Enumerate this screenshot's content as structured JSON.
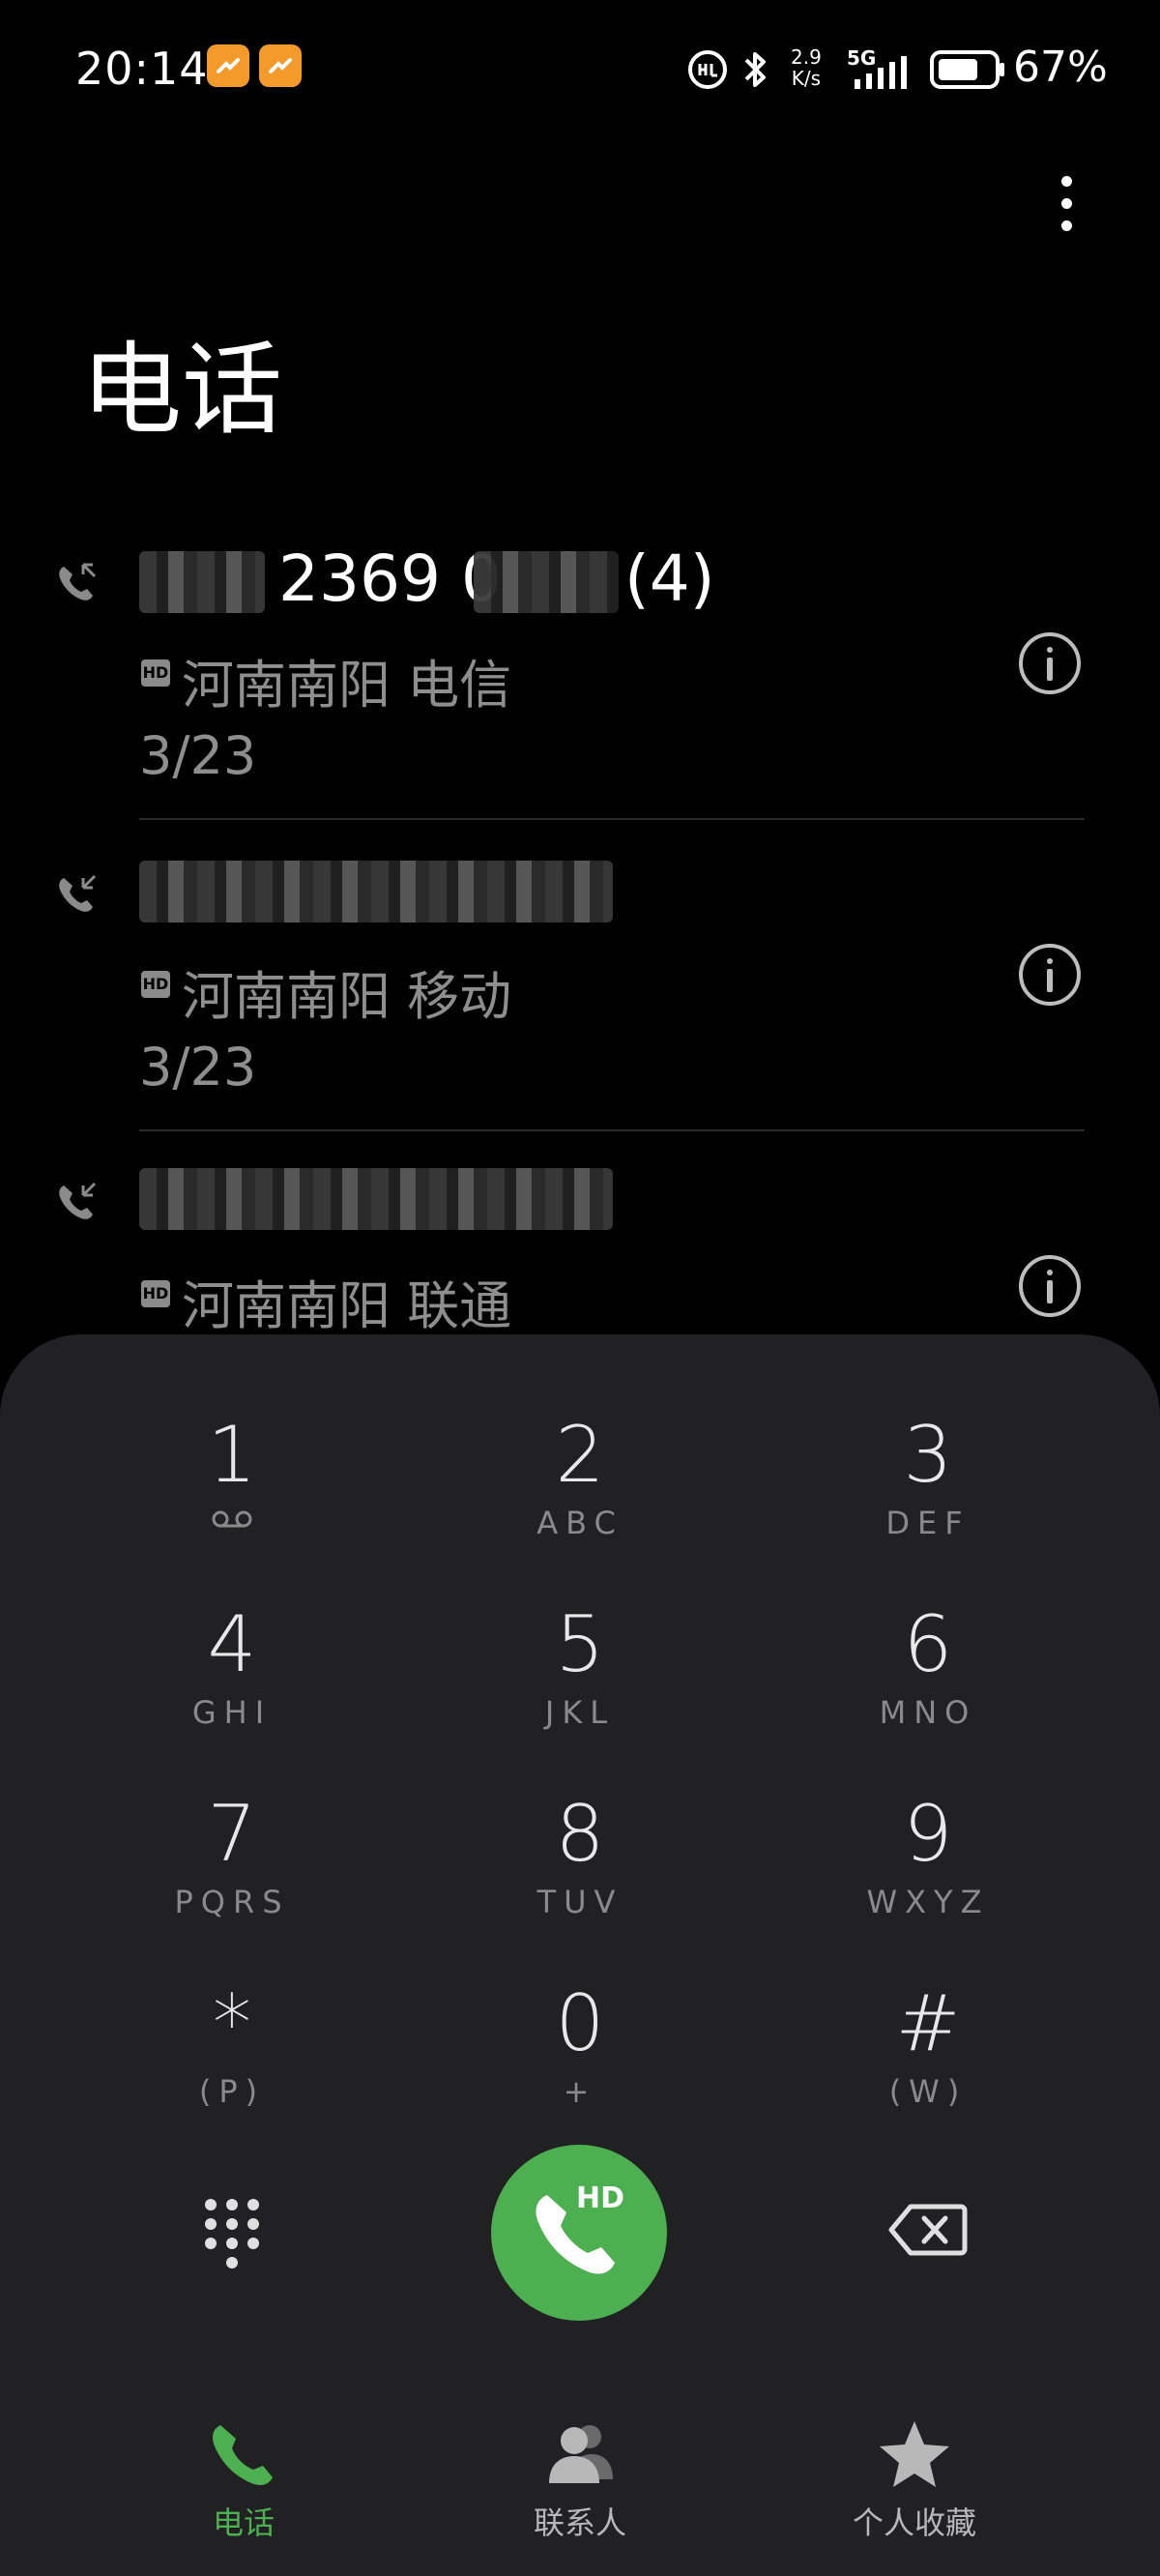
{
  "status_bar": {
    "time": "20:14",
    "net_speed_value": "2.9",
    "net_speed_unit": "K/s",
    "network": "5G",
    "battery": "67%"
  },
  "header": {
    "title": "电话"
  },
  "calls": [
    {
      "number_visible": "2369 0",
      "count": "(4)",
      "location": "河南南阳 电信",
      "date": "3/23"
    },
    {
      "number_visible": "",
      "count": "",
      "location": "河南南阳 移动",
      "date": "3/23"
    },
    {
      "number_visible": "",
      "count": "",
      "location": "河南南阳 联通",
      "date": ""
    }
  ],
  "hd_label": "HD",
  "dialpad": {
    "keys": [
      {
        "digit": "1",
        "letters": ""
      },
      {
        "digit": "2",
        "letters": "ABC"
      },
      {
        "digit": "3",
        "letters": "DEF"
      },
      {
        "digit": "4",
        "letters": "GHI"
      },
      {
        "digit": "5",
        "letters": "JKL"
      },
      {
        "digit": "6",
        "letters": "MNO"
      },
      {
        "digit": "7",
        "letters": "PQRS"
      },
      {
        "digit": "8",
        "letters": "TUV"
      },
      {
        "digit": "9",
        "letters": "WXYZ"
      },
      {
        "digit": "*",
        "letters": "(P)"
      },
      {
        "digit": "0",
        "letters": "+"
      },
      {
        "digit": "#",
        "letters": "(W)"
      }
    ],
    "call_hd": "HD"
  },
  "nav": {
    "phone": "电话",
    "contacts": "联系人",
    "favorites": "个人收藏",
    "active_color": "#4caf50",
    "inactive_color": "#b8b8b8"
  },
  "colors": {
    "background": "#000000",
    "dialpad_bg": "#212123",
    "accent": "#4caf50"
  }
}
